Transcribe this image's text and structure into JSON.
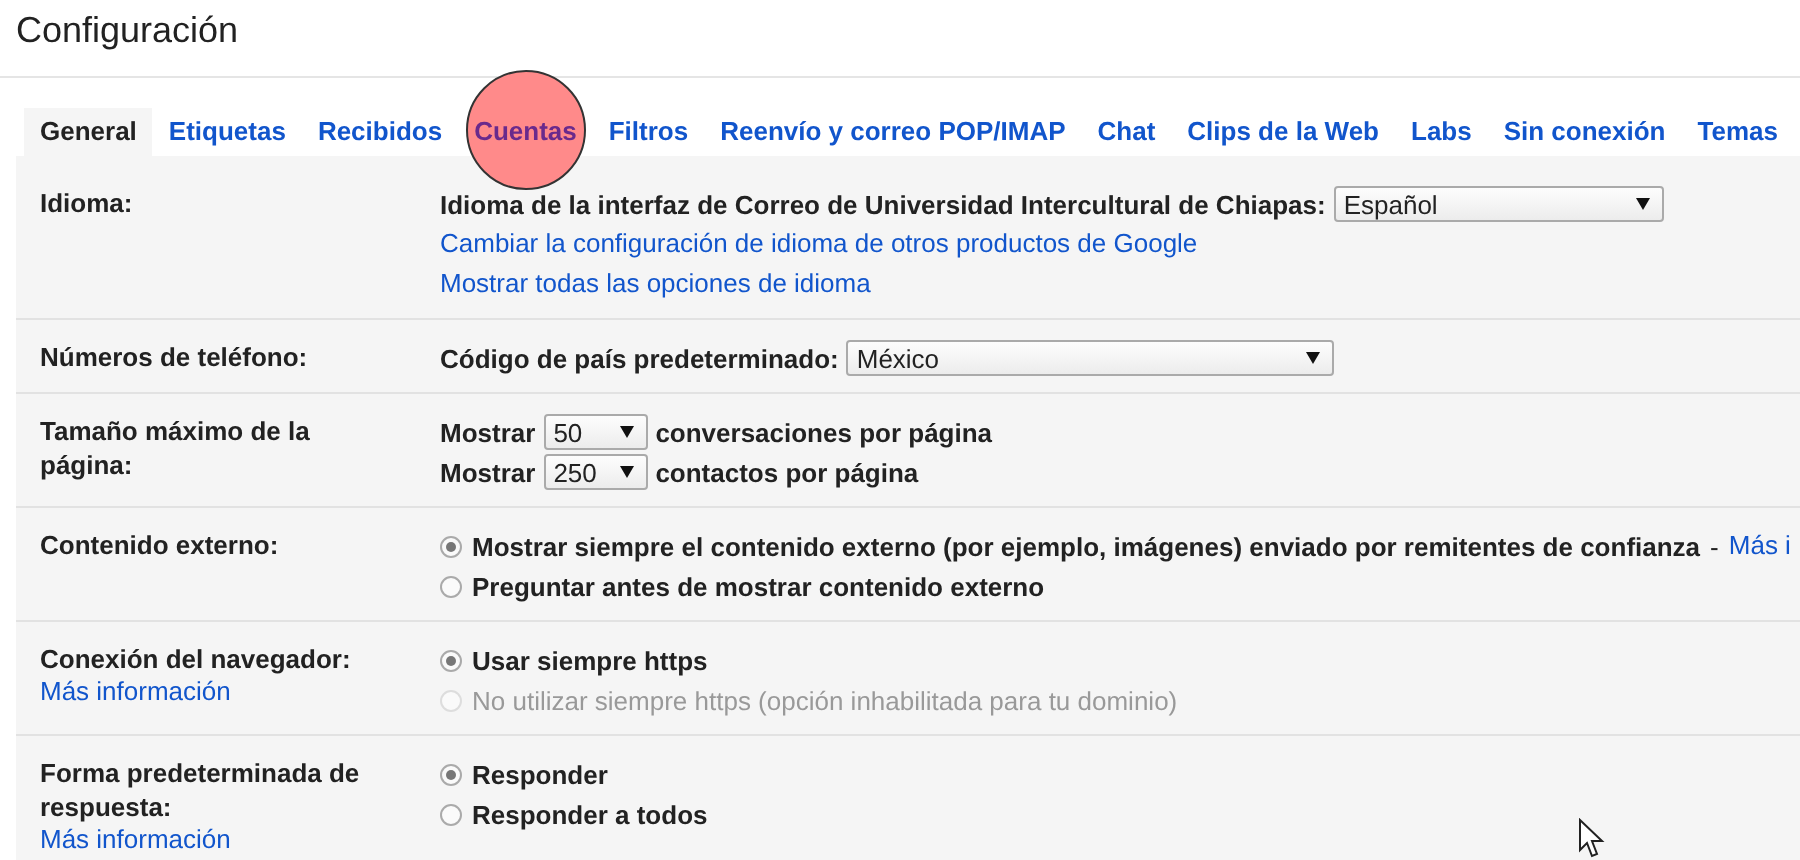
{
  "title": "Configuración",
  "tabs": [
    {
      "label": "General",
      "selected": true,
      "highlighted": false
    },
    {
      "label": "Etiquetas",
      "selected": false,
      "highlighted": false
    },
    {
      "label": "Recibidos",
      "selected": false,
      "highlighted": false
    },
    {
      "label": "Cuentas",
      "selected": false,
      "highlighted": true
    },
    {
      "label": "Filtros",
      "selected": false,
      "highlighted": false
    },
    {
      "label": "Reenvío y correo POP/IMAP",
      "selected": false,
      "highlighted": false
    },
    {
      "label": "Chat",
      "selected": false,
      "highlighted": false
    },
    {
      "label": "Clips de la Web",
      "selected": false,
      "highlighted": false
    },
    {
      "label": "Labs",
      "selected": false,
      "highlighted": false
    },
    {
      "label": "Sin conexión",
      "selected": false,
      "highlighted": false
    },
    {
      "label": "Temas",
      "selected": false,
      "highlighted": false
    }
  ],
  "sections": [
    {
      "label": "Idioma:",
      "items": [
        {
          "kind": "select",
          "prefix": "Idioma de la interfaz de Correo de Universidad Intercultural de Chiapas:",
          "value": "Español"
        },
        {
          "kind": "link",
          "text": "Cambiar la configuración de idioma de otros productos de Google"
        },
        {
          "kind": "link",
          "text": "Mostrar todas las opciones de idioma"
        }
      ]
    },
    {
      "label": "Números de teléfono:",
      "items": [
        {
          "kind": "select",
          "prefix": "Código de país predeterminado:",
          "value": "México"
        }
      ]
    },
    {
      "label": "Tamaño máximo de la página:",
      "items": [
        {
          "kind": "select",
          "prefix": "Mostrar",
          "value": "50",
          "suffix": "conversaciones por página"
        },
        {
          "kind": "select",
          "prefix": "Mostrar",
          "value": "250",
          "suffix": "contactos por página"
        }
      ]
    },
    {
      "label": "Contenido externo:",
      "items": [
        {
          "kind": "radio",
          "label": "Mostrar siempre el contenido externo (por ejemplo, imágenes) enviado por remitentes de confianza",
          "separator": "-",
          "link": "Más i",
          "selected": true,
          "disabled": false
        },
        {
          "kind": "radio",
          "label": "Preguntar antes de mostrar contenido externo",
          "selected": false,
          "disabled": false
        }
      ]
    },
    {
      "label": "Conexión del navegador:",
      "link": "Más información",
      "items": [
        {
          "kind": "radio",
          "label": "Usar siempre https",
          "selected": true,
          "disabled": false
        },
        {
          "kind": "radio",
          "label": "No utilizar siempre https (opción inhabilitada para tu dominio)",
          "selected": false,
          "disabled": true
        }
      ]
    },
    {
      "label": "Forma predeterminada de respuesta:",
      "link": "Más información",
      "items": [
        {
          "kind": "radio",
          "label": "Responder",
          "selected": true,
          "disabled": false
        },
        {
          "kind": "radio",
          "label": "Responder a todos",
          "selected": false,
          "disabled": false
        }
      ]
    }
  ]
}
